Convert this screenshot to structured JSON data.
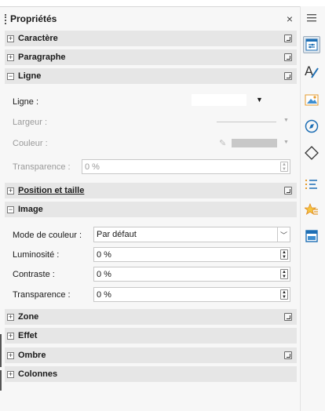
{
  "panel": {
    "title": "Propriétés",
    "close": "×"
  },
  "sections": {
    "caractere": "Caractère",
    "paragraphe": "Paragraphe",
    "ligne": "Ligne",
    "position": "Position et taille",
    "image": "Image",
    "zone": "Zone",
    "effet": "Effet",
    "ombre": "Ombre",
    "colonnes": "Colonnes"
  },
  "ligne": {
    "ligne_label": "Ligne :",
    "largeur_label": "Largeur :",
    "couleur_label": "Couleur :",
    "transparence_label": "Transparence :",
    "transparence_value": "0 %"
  },
  "image": {
    "mode_label": "Mode de couleur :",
    "mode_value": "Par défaut",
    "luminosite_label": "Luminosité :",
    "luminosite_value": "0 %",
    "contraste_label": "Contraste :",
    "contraste_value": "0 %",
    "transparence_label": "Transparence :",
    "transparence_value": "0 %"
  },
  "toggles": {
    "expanded": "−",
    "collapsed": "+"
  },
  "colors": {
    "accent": "#1e6fb5",
    "section_bg": "#e6e6e6",
    "panel_bg": "#f7f7f7"
  },
  "sidebar_icons": [
    "menu-icon",
    "properties-icon",
    "styles-icon",
    "gallery-icon",
    "navigator-icon",
    "shapes-icon",
    "list-icon",
    "star-icon",
    "page-icon"
  ]
}
